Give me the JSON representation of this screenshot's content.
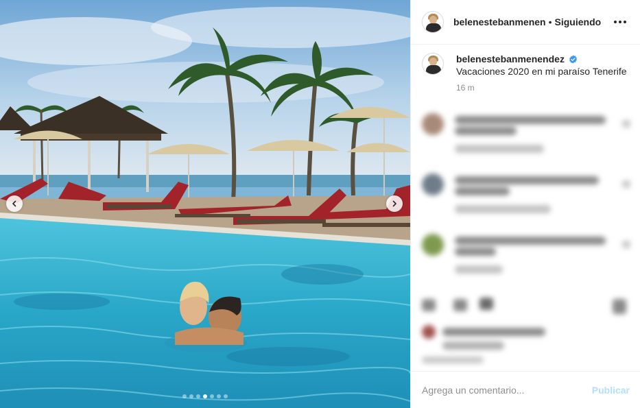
{
  "header": {
    "username": "belenestebanmenen",
    "separator": "•",
    "follow_label": "Siguiendo",
    "more_icon": "more-horizontal-icon"
  },
  "caption": {
    "username": "belenestebanmenendez",
    "verified_icon": "verified-badge-icon",
    "text": "Vacaciones 2020 en mi paraíso Tenerife",
    "time": "16 m"
  },
  "media": {
    "prev_icon": "chevron-left-icon",
    "next_icon": "chevron-right-icon",
    "carousel": {
      "count": 7,
      "active": 3
    }
  },
  "comment_box": {
    "placeholder": "Agrega un comentario...",
    "publish_label": "Publicar"
  },
  "colors": {
    "text": "#262626",
    "muted": "#8e8e8e",
    "publish_disabled": "#b2dffc",
    "verified": "#3897f0"
  }
}
